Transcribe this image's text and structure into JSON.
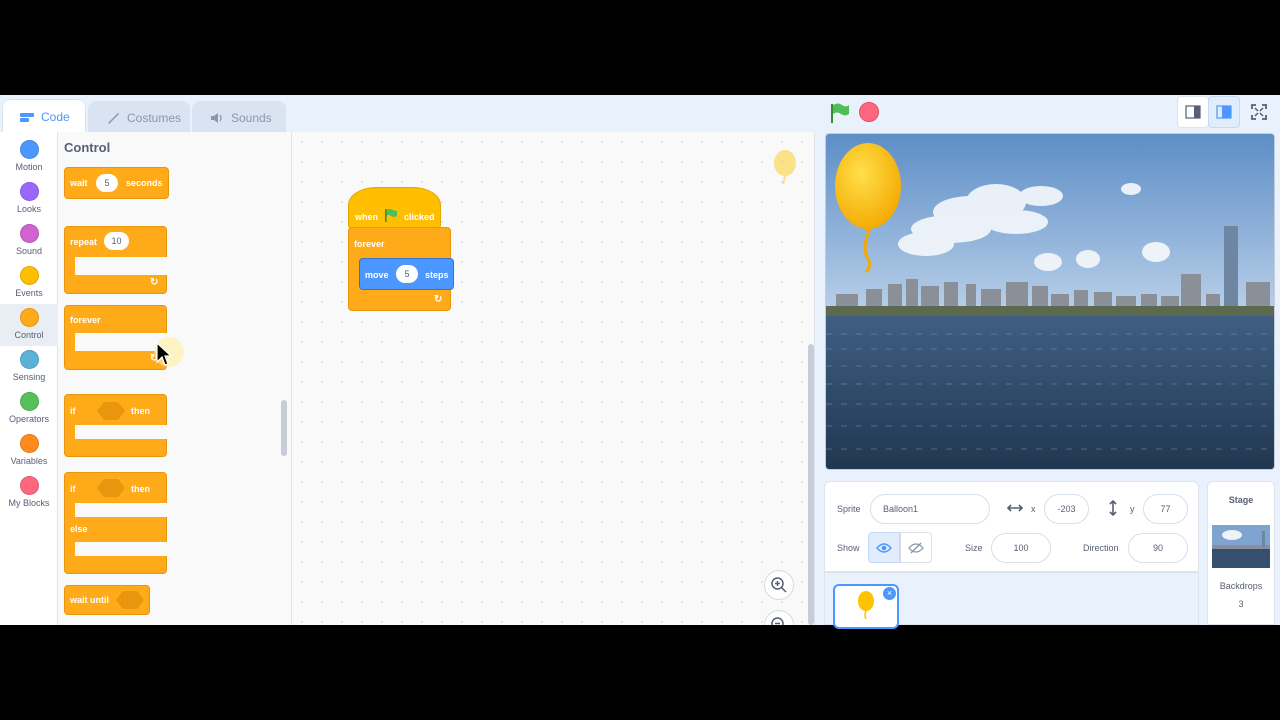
{
  "tabs": [
    {
      "label": "Code",
      "icon": "code-icon",
      "active": true
    },
    {
      "label": "Costumes",
      "icon": "brush-icon",
      "active": false
    },
    {
      "label": "Sounds",
      "icon": "speaker-icon",
      "active": false
    }
  ],
  "categories": [
    {
      "label": "Motion",
      "color": "#4c97ff"
    },
    {
      "label": "Looks",
      "color": "#9966ff"
    },
    {
      "label": "Sound",
      "color": "#cf63cf"
    },
    {
      "label": "Events",
      "color": "#ffbf00"
    },
    {
      "label": "Control",
      "color": "#ffab19"
    },
    {
      "label": "Sensing",
      "color": "#5cb1d6"
    },
    {
      "label": "Operators",
      "color": "#59c059"
    },
    {
      "label": "Variables",
      "color": "#ff8c1a"
    },
    {
      "label": "My Blocks",
      "color": "#ff6680"
    }
  ],
  "palette": {
    "title": "Control",
    "wait": {
      "label": "wait",
      "value": "5",
      "unit": "seconds"
    },
    "repeat": {
      "label": "repeat",
      "value": "10"
    },
    "forever": {
      "label": "forever"
    },
    "if_then": {
      "if": "if",
      "then": "then"
    },
    "if_else": {
      "if": "if",
      "then": "then",
      "else": "else"
    },
    "wait_until": {
      "label": "wait until"
    }
  },
  "script": {
    "hat": {
      "when": "when",
      "clicked": "clicked"
    },
    "forever": "forever",
    "move": {
      "label": "move",
      "value": "5",
      "unit": "steps"
    }
  },
  "sprite_info": {
    "sprite_label": "Sprite",
    "sprite_name": "Balloon1",
    "x_label": "x",
    "x_value": "-203",
    "y_label": "y",
    "y_value": "77",
    "show_label": "Show",
    "size_label": "Size",
    "size_value": "100",
    "direction_label": "Direction",
    "direction_value": "90"
  },
  "stage_panel": {
    "title": "Stage",
    "backdrops_label": "Backdrops",
    "backdrops_count": "3"
  },
  "colors": {
    "control": "#ffab19",
    "motion": "#4c97ff",
    "accent": "#4c97ff"
  }
}
